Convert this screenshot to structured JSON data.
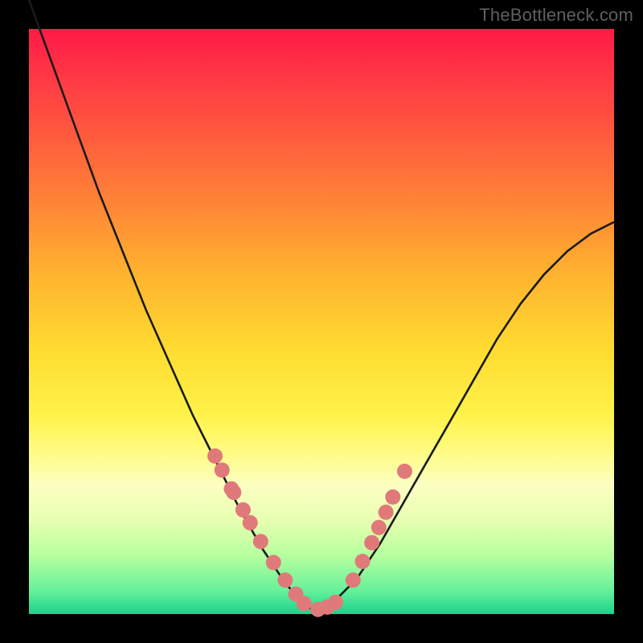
{
  "watermark": "TheBottleneck.com",
  "colors": {
    "frame": "#000000",
    "curve_stroke": "#1a1a1a",
    "marker_fill": "#e07a7a",
    "marker_stroke": "#d86c6c"
  },
  "chart_data": {
    "type": "line",
    "title": "",
    "xlabel": "",
    "ylabel": "",
    "xlim": [
      0,
      1
    ],
    "ylim": [
      0,
      1
    ],
    "series": [
      {
        "name": "bottleneck-curve",
        "x": [
          0.0,
          0.04,
          0.08,
          0.12,
          0.16,
          0.2,
          0.24,
          0.28,
          0.32,
          0.36,
          0.4,
          0.44,
          0.48,
          0.52,
          0.56,
          0.6,
          0.64,
          0.68,
          0.72,
          0.76,
          0.8,
          0.84,
          0.88,
          0.92,
          0.96,
          1.0
        ],
        "y": [
          1.05,
          0.94,
          0.83,
          0.72,
          0.62,
          0.52,
          0.43,
          0.34,
          0.26,
          0.18,
          0.11,
          0.05,
          0.01,
          0.02,
          0.06,
          0.12,
          0.19,
          0.26,
          0.33,
          0.4,
          0.47,
          0.53,
          0.58,
          0.62,
          0.65,
          0.67
        ]
      }
    ],
    "markers": {
      "name": "highlighted-points",
      "x": [
        0.318,
        0.33,
        0.346,
        0.35,
        0.366,
        0.378,
        0.396,
        0.418,
        0.438,
        0.456,
        0.47,
        0.494,
        0.51,
        0.524,
        0.554,
        0.57,
        0.586,
        0.598,
        0.61,
        0.622,
        0.642
      ],
      "y": [
        0.27,
        0.246,
        0.214,
        0.208,
        0.178,
        0.156,
        0.124,
        0.088,
        0.058,
        0.034,
        0.018,
        0.008,
        0.012,
        0.02,
        0.058,
        0.09,
        0.122,
        0.148,
        0.174,
        0.2,
        0.244
      ]
    }
  }
}
